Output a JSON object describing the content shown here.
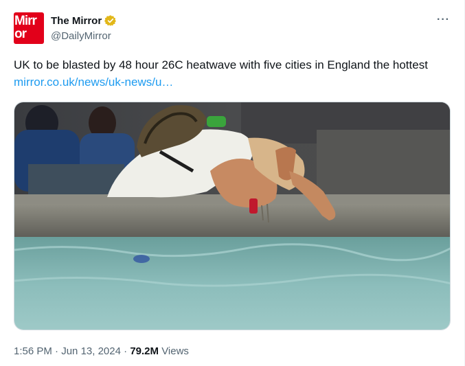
{
  "account": {
    "display_name": "The Mirror",
    "handle": "@DailyMirror",
    "avatar_text": [
      "Mirr",
      "or"
    ],
    "avatar_color": "#e2001a",
    "verified_badge": "gold-verified-icon"
  },
  "tweet": {
    "text": "UK to be blasted by 48 hour 26C heatwave with five cities in England the hottest ",
    "link": "mirror.co.uk/news/uk-news/u…",
    "link_color": "#1d9bf0"
  },
  "media": {
    "description_icon": "photo"
  },
  "meta": {
    "time": "1:56 PM",
    "separator": "·",
    "date": "Jun 13, 2024",
    "views_count": "79.2M",
    "views_label": "Views"
  },
  "more_icon": "more-icon"
}
